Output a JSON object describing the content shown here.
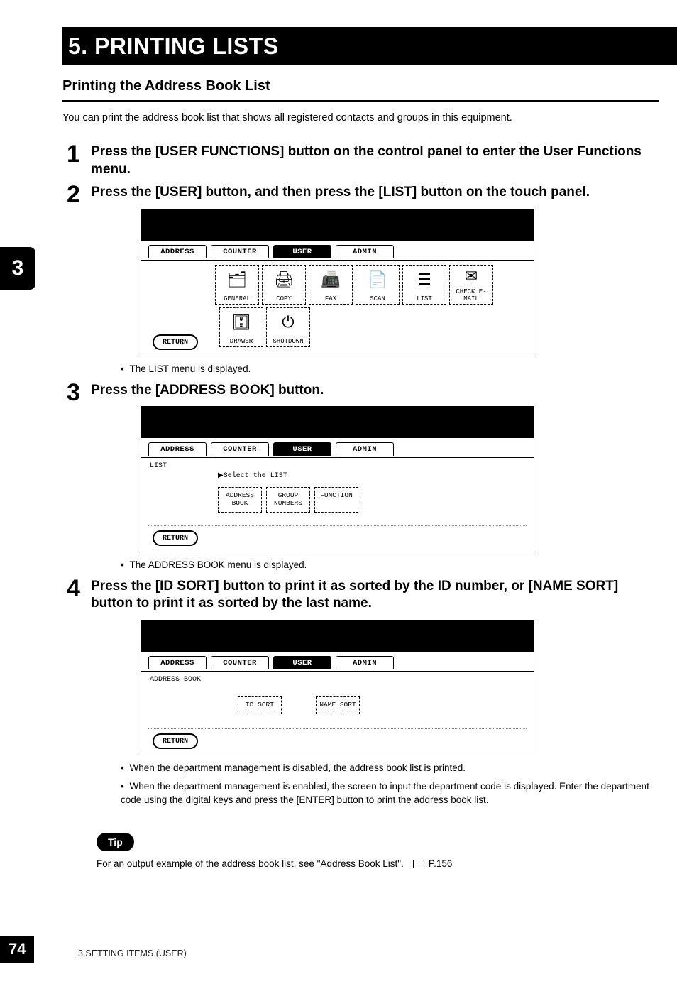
{
  "chapter": {
    "title": "5. PRINTING LISTS"
  },
  "section": {
    "title": "Printing the Address Book List"
  },
  "intro": "You can print the address book list that shows all registered contacts and groups in this equipment.",
  "sidebar": {
    "chapter_num": "3"
  },
  "steps": {
    "s1": {
      "num": "1",
      "text": "Press the [USER FUNCTIONS] button on the control panel to enter the User Functions menu."
    },
    "s2": {
      "num": "2",
      "text": "Press the [USER] button, and then press the [LIST] button on the touch panel.",
      "bullet": "The LIST menu is displayed."
    },
    "s3": {
      "num": "3",
      "text": "Press the [ADDRESS BOOK] button.",
      "bullet": "The ADDRESS BOOK menu is displayed."
    },
    "s4": {
      "num": "4",
      "text": "Press the [ID SORT] button to print it as sorted by the ID number, or [NAME SORT] button to print it as sorted by the last name.",
      "bullets": [
        "When the department management is disabled, the address book list is printed.",
        "When the department management is enabled, the screen to input the department code is displayed.  Enter the department code using the digital keys and press the [ENTER] button to print the address book list."
      ]
    }
  },
  "panel": {
    "tabs": {
      "address": "ADDRESS",
      "counter": "COUNTER",
      "user": "USER",
      "admin": "ADMIN"
    },
    "icons": {
      "general": "GENERAL",
      "copy": "COPY",
      "fax": "FAX",
      "scan": "SCAN",
      "list": "LIST",
      "checkemail": "CHECK E-MAIL",
      "drawer": "DRAWER",
      "shutdown": "SHUTDOWN"
    },
    "return": "RETURN",
    "list_sub": "LIST",
    "list_prompt": "▶Select the LIST",
    "list_btns": {
      "address_book": "ADDRESS\nBOOK",
      "group_numbers": "GROUP\nNUMBERS",
      "function": "FUNCTION"
    },
    "ab_sub": "ADDRESS BOOK",
    "sort_btns": {
      "id": "ID SORT",
      "name": "NAME SORT"
    }
  },
  "tip": {
    "label": "Tip",
    "text_pre": "For an output example of the address book list, see \"Address Book List\".",
    "page_ref": "P.156"
  },
  "footer": {
    "section": "3.SETTING ITEMS (USER)",
    "page": "74"
  }
}
